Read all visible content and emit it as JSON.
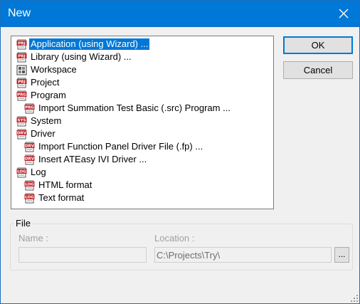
{
  "window": {
    "title": "New",
    "close_icon": "close-icon"
  },
  "tree": {
    "items": [
      {
        "label": "Application (using Wizard) ...",
        "icon": "project-icon",
        "icon_text": "PRJ",
        "selected": true,
        "indent": 0
      },
      {
        "label": "Library (using Wizard) ...",
        "icon": "project-icon",
        "icon_text": "PRJ",
        "indent": 0
      },
      {
        "label": "Workspace",
        "icon": "workspace-icon",
        "icon_text": "",
        "indent": 0
      },
      {
        "label": "Project",
        "icon": "project-icon",
        "icon_text": "PRJ",
        "indent": 0
      },
      {
        "label": "Program",
        "icon": "program-icon",
        "icon_text": "PRG",
        "indent": 0
      },
      {
        "label": "Import Summation Test Basic (.src) Program ...",
        "icon": "program-icon",
        "icon_text": "PRG",
        "indent": 1
      },
      {
        "label": "System",
        "icon": "system-icon",
        "icon_text": "SYS",
        "indent": 0
      },
      {
        "label": "Driver",
        "icon": "driver-icon",
        "icon_text": "DRV",
        "indent": 0
      },
      {
        "label": "Import Function Panel Driver File (.fp) ...",
        "icon": "driver-icon",
        "icon_text": "DRV",
        "indent": 1
      },
      {
        "label": "Insert ATEasy IVI Driver ...",
        "icon": "driver-icon",
        "icon_text": "DRV",
        "indent": 1
      },
      {
        "label": "Log",
        "icon": "log-icon",
        "icon_text": "LOG",
        "indent": 0
      },
      {
        "label": "HTML format",
        "icon": "log-icon",
        "icon_text": "LOG",
        "indent": 1
      },
      {
        "label": "Text format",
        "icon": "log-icon",
        "icon_text": "LOG",
        "indent": 1
      }
    ]
  },
  "buttons": {
    "ok": "OK",
    "cancel": "Cancel",
    "browse": "..."
  },
  "file_group": {
    "title": "File",
    "name_label": "Name :",
    "name_value": "",
    "location_label": "Location :",
    "location_value": "C:\\Projects\\Try\\"
  },
  "colors": {
    "titlebar": "#0078d7",
    "selection": "#0078d7",
    "icon_red": "#c0282d"
  }
}
